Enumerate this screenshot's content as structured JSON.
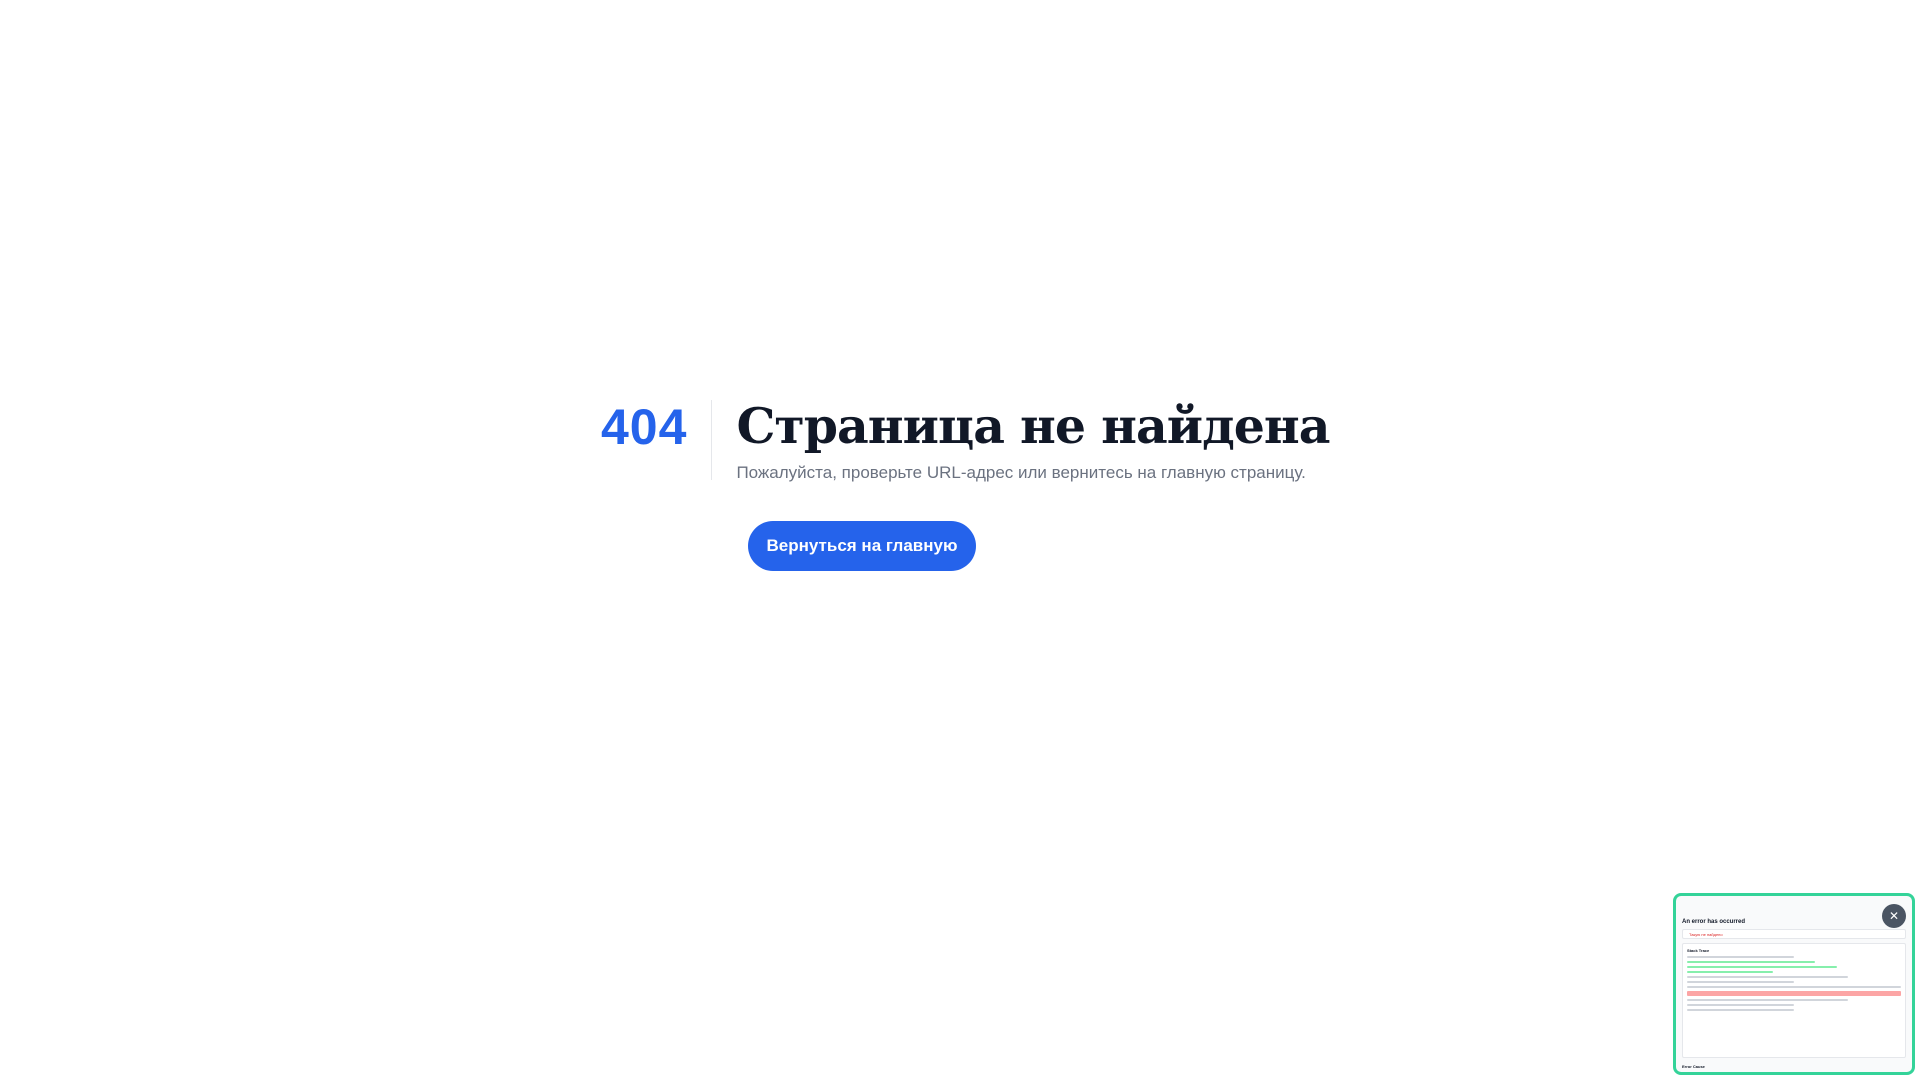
{
  "error_page": {
    "code": "404",
    "title": "Страница не найдена",
    "subtitle": "Пожалуйста, проверьте URL-адрес или вернитесь на главную страницу.",
    "home_button_label": "Вернуться на главную"
  },
  "error_overlay": {
    "close_icon": "✕",
    "heading": "An error has occurred",
    "message": "Такую не найдено",
    "stack_section": "Stack Trace",
    "footer_section": "Error Cause"
  },
  "colors": {
    "accent": "#2563eb",
    "title": "#111827",
    "subtitle": "#6b7280",
    "overlay_border": "#34d399"
  }
}
